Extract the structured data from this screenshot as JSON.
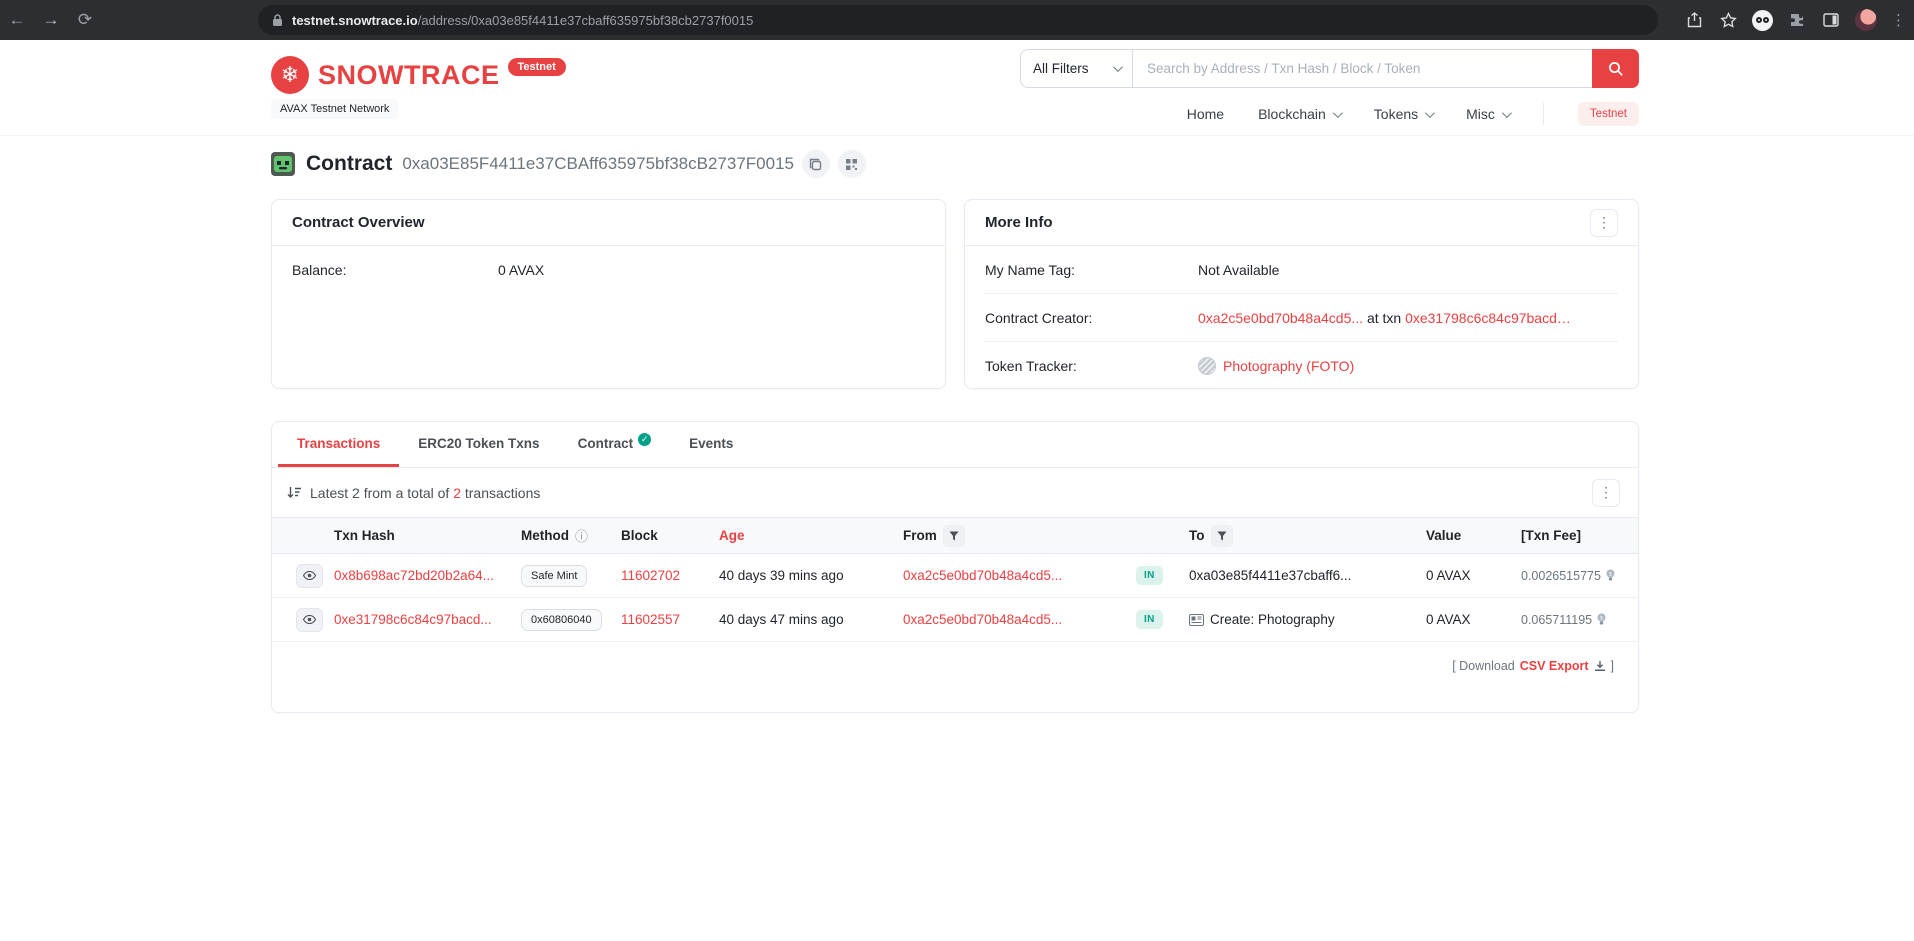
{
  "colors": {
    "brand_red": "#e84142",
    "in_badge_green": "#00a186"
  },
  "browser": {
    "url_host": "testnet.snowtrace.io",
    "url_path": "/address/0xa03e85f4411e37cbaff635975bf38cb2737f0015"
  },
  "header": {
    "brand": "SNOWTRACE",
    "brand_badge": "Testnet",
    "network_label": "AVAX Testnet Network",
    "search": {
      "filter_label": "All Filters",
      "placeholder": "Search by Address / Txn Hash / Block / Token"
    },
    "nav": [
      {
        "label": "Home"
      },
      {
        "label": "Blockchain"
      },
      {
        "label": "Tokens"
      },
      {
        "label": "Misc"
      }
    ],
    "nav_badge": "Testnet"
  },
  "page": {
    "type_label": "Contract",
    "address": "0xa03E85F4411e37CBAff635975bf38cB2737F0015"
  },
  "overview_card": {
    "title": "Contract Overview",
    "balance_label": "Balance:",
    "balance_value": "0 AVAX"
  },
  "more_info_card": {
    "title": "More Info",
    "name_tag_label": "My Name Tag:",
    "name_tag_value": "Not Available",
    "creator_label": "Contract Creator:",
    "creator_address": "0xa2c5e0bd70b48a4cd5...",
    "creator_at_txn": "at txn",
    "creator_txn": "0xe31798c6c84c97bacd…",
    "tracker_label": "Token Tracker:",
    "tracker_value": "Photography (FOTO)"
  },
  "tabs": [
    {
      "label": "Transactions"
    },
    {
      "label": "ERC20 Token Txns"
    },
    {
      "label": "Contract"
    },
    {
      "label": "Events"
    }
  ],
  "transactions": {
    "summary_prefix": "Latest 2 from a total of",
    "summary_total": "2",
    "summary_suffix": "transactions",
    "columns": {
      "txn_hash": "Txn Hash",
      "method": "Method",
      "block": "Block",
      "age": "Age",
      "from": "From",
      "to": "To",
      "value": "Value",
      "fee": "[Txn Fee]"
    },
    "rows": [
      {
        "hash": "0x8b698ac72bd20b2a64...",
        "method": "Safe Mint",
        "block": "11602702",
        "age": "40 days 39 mins ago",
        "from": "0xa2c5e0bd70b48a4cd5...",
        "direction": "IN",
        "to": "0xa03e85f4411e37cbaff6...",
        "value": "0 AVAX",
        "fee": "0.0026515775"
      },
      {
        "hash": "0xe31798c6c84c97bacd...",
        "method": "0x60806040",
        "block": "11602557",
        "age": "40 days 47 mins ago",
        "from": "0xa2c5e0bd70b48a4cd5...",
        "direction": "IN",
        "to": "Create: Photography",
        "value": "0 AVAX",
        "fee": "0.065711195"
      }
    ],
    "download_prefix": "[ Download",
    "download_link": "CSV Export",
    "download_suffix": "]"
  }
}
